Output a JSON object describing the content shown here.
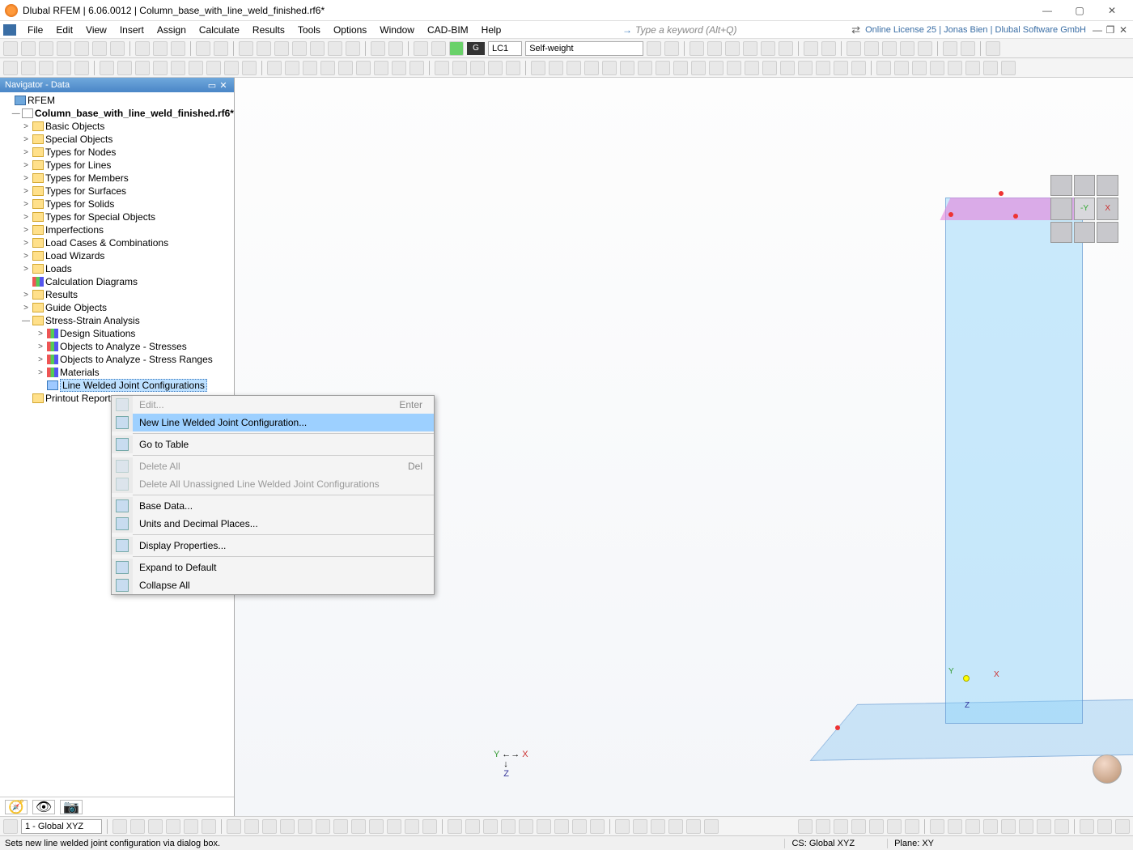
{
  "window": {
    "title": "Dlubal RFEM | 6.06.0012 | Column_base_with_line_weld_finished.rf6*",
    "license_text": "Online License 25 | Jonas Bien | Dlubal Software GmbH"
  },
  "menu": [
    "File",
    "Edit",
    "View",
    "Insert",
    "Assign",
    "Calculate",
    "Results",
    "Tools",
    "Options",
    "Window",
    "CAD-BIM",
    "Help"
  ],
  "search_placeholder": "Type a keyword (Alt+Q)",
  "toolbar1": {
    "g_label": "G",
    "lc_label": "LC1",
    "lc_desc": "Self-weight"
  },
  "navigator": {
    "title": "Navigator - Data",
    "root": "RFEM",
    "project": "Column_base_with_line_weld_finished.rf6*",
    "items": [
      {
        "label": "Basic Objects",
        "icon": "folder",
        "exp": ">"
      },
      {
        "label": "Special Objects",
        "icon": "folder",
        "exp": ">"
      },
      {
        "label": "Types for Nodes",
        "icon": "folder",
        "exp": ">"
      },
      {
        "label": "Types for Lines",
        "icon": "folder",
        "exp": ">"
      },
      {
        "label": "Types for Members",
        "icon": "folder",
        "exp": ">"
      },
      {
        "label": "Types for Surfaces",
        "icon": "folder",
        "exp": ">"
      },
      {
        "label": "Types for Solids",
        "icon": "folder",
        "exp": ">"
      },
      {
        "label": "Types for Special Objects",
        "icon": "folder",
        "exp": ">"
      },
      {
        "label": "Imperfections",
        "icon": "folder",
        "exp": ">"
      },
      {
        "label": "Load Cases & Combinations",
        "icon": "folder",
        "exp": ">"
      },
      {
        "label": "Load Wizards",
        "icon": "folder",
        "exp": ">"
      },
      {
        "label": "Loads",
        "icon": "folder",
        "exp": ">"
      },
      {
        "label": "Calculation Diagrams",
        "icon": "chart",
        "exp": " "
      },
      {
        "label": "Results",
        "icon": "folder",
        "exp": ">"
      },
      {
        "label": "Guide Objects",
        "icon": "folder",
        "exp": ">"
      }
    ],
    "stress_label": "Stress-Strain Analysis",
    "stress_children": [
      {
        "label": "Design Situations",
        "icon": "chart"
      },
      {
        "label": "Objects to Analyze - Stresses",
        "icon": "chart"
      },
      {
        "label": "Objects to Analyze - Stress Ranges",
        "icon": "chart"
      },
      {
        "label": "Materials",
        "icon": "chart"
      }
    ],
    "selected_label": "Line Welded Joint Configurations",
    "printout_label": "Printout Report"
  },
  "context_menu": [
    {
      "label": "Edit...",
      "shortcut": "Enter",
      "disabled": true
    },
    {
      "label": "New Line Welded Joint Configuration...",
      "hovered": true
    },
    {
      "sep": true
    },
    {
      "label": "Go to Table"
    },
    {
      "sep": true
    },
    {
      "label": "Delete All",
      "shortcut": "Del",
      "disabled": true
    },
    {
      "label": "Delete All Unassigned Line Welded Joint Configurations",
      "disabled": true
    },
    {
      "sep": true
    },
    {
      "label": "Base Data..."
    },
    {
      "label": "Units and Decimal Places..."
    },
    {
      "sep": true
    },
    {
      "label": "Display Properties..."
    },
    {
      "sep": true
    },
    {
      "label": "Expand to Default"
    },
    {
      "label": "Collapse All"
    }
  ],
  "status_toolbar": {
    "cs_combo": "1 - Global XYZ"
  },
  "statusbar": {
    "hint": "Sets new line welded joint configuration via dialog box.",
    "cs": "CS: Global XYZ",
    "plane": "Plane: XY"
  },
  "viewport_axes": {
    "x": "X",
    "y": "Y",
    "z": "Z"
  },
  "nav_cube": {
    "y": "-Y",
    "x": "X"
  }
}
